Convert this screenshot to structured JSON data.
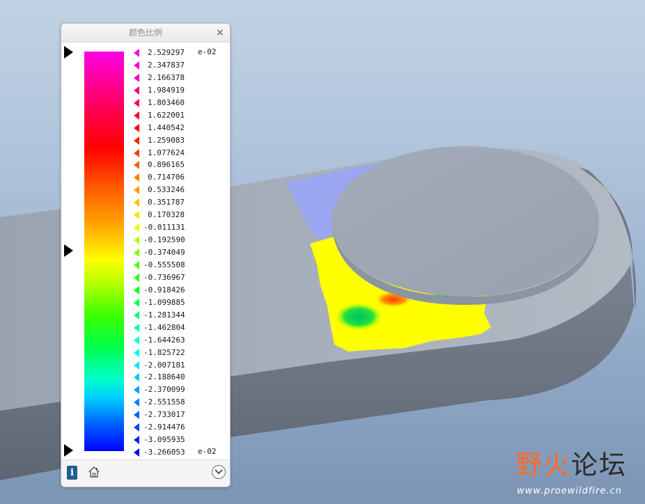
{
  "dialog": {
    "title": "颜色比例",
    "close_label": "×",
    "exponent_label": "e-02",
    "scale_values": [
      "2.529297",
      "2.347837",
      "2.166378",
      "1.984919",
      "1.803460",
      "1.622001",
      "1.440542",
      "1.259083",
      "1.077624",
      "0.896165",
      "0.714706",
      "0.533246",
      "0.351787",
      "0.170328",
      "-0.011131",
      "-0.192590",
      "-0.374049",
      "-0.555508",
      "-0.736967",
      "-0.918426",
      "-1.099885",
      "-1.281344",
      "-1.462804",
      "-1.644263",
      "-1.825722",
      "-2.007181",
      "-2.188640",
      "-2.370099",
      "-2.551558",
      "-2.733017",
      "-2.914476",
      "-3.095935",
      "-3.266053"
    ],
    "tick_colors": [
      "#ff00e6",
      "#ff00c8",
      "#ff00aa",
      "#ff0080",
      "#ff005a",
      "#ff0030",
      "#ff0000",
      "#ff2000",
      "#ff4000",
      "#ff6000",
      "#ff8000",
      "#ff9900",
      "#ffc000",
      "#ffe000",
      "#e6ff00",
      "#b4ff00",
      "#80ff00",
      "#50ff00",
      "#30ff00",
      "#00ff20",
      "#00ff4a",
      "#00ff80",
      "#00ffa8",
      "#00ffcc",
      "#00ffe8",
      "#00e8ff",
      "#00c8ff",
      "#00a0ff",
      "#0080ff",
      "#0064ff",
      "#0040ff",
      "#0020ff",
      "#0000ff"
    ],
    "footer": {
      "info_icon_text": "i"
    }
  },
  "watermark": {
    "part1": "野火",
    "part2": "论坛",
    "url": "www.proewildfire.cn"
  }
}
